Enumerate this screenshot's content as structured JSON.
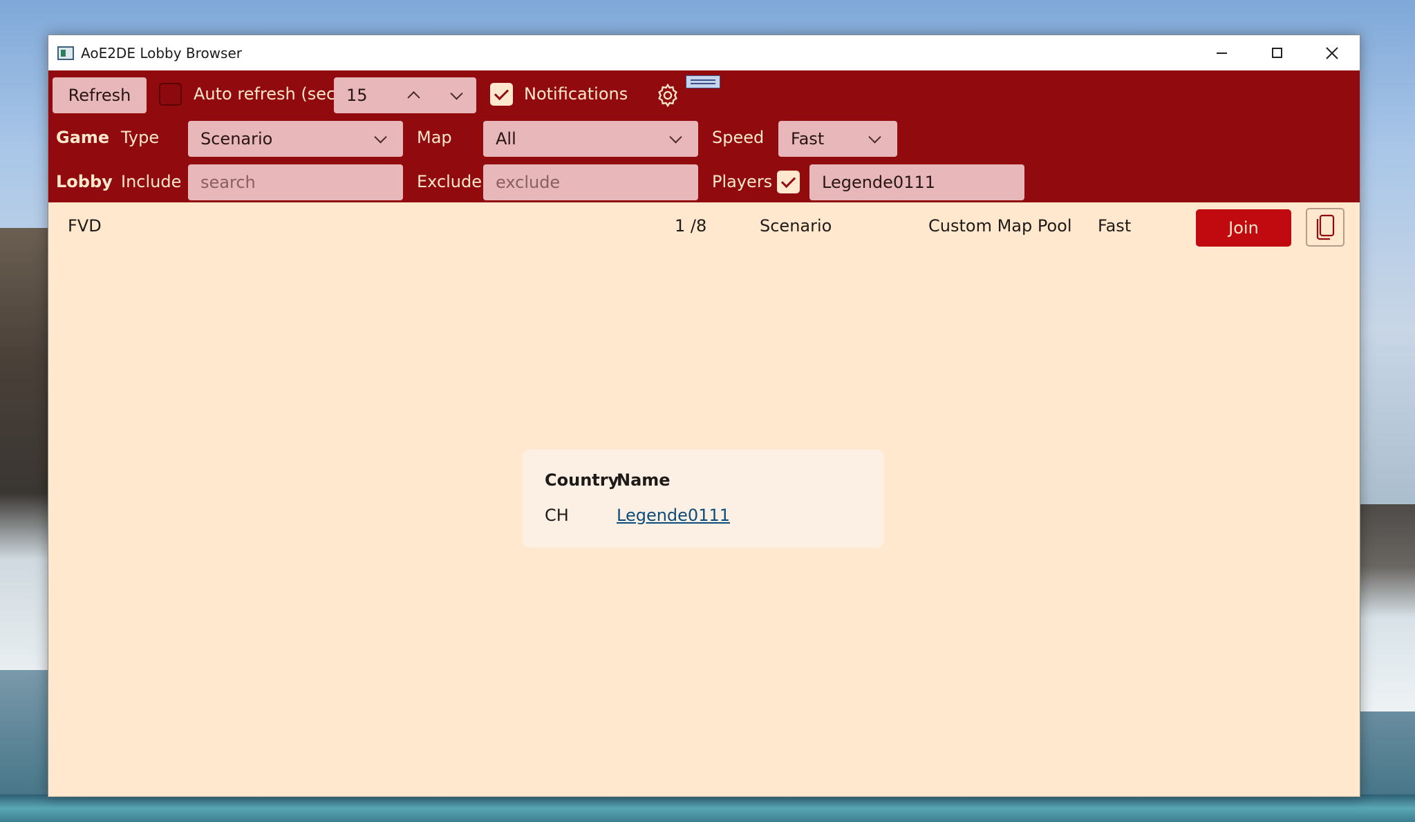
{
  "window": {
    "title": "AoE2DE Lobby Browser",
    "controls": [
      "minimize",
      "maximize",
      "close"
    ]
  },
  "toolbar": {
    "refresh_label": "Refresh",
    "auto_refresh": {
      "label": "Auto refresh (sec)",
      "checked": false,
      "value": "15"
    },
    "notifications": {
      "label": "Notifications",
      "checked": true
    },
    "settings_icon": "gear-icon"
  },
  "game_filters": {
    "section_label": "Game",
    "type": {
      "label": "Type",
      "value": "Scenario"
    },
    "map": {
      "label": "Map",
      "value": "All"
    },
    "speed": {
      "label": "Speed",
      "value": "Fast"
    }
  },
  "lobby_filters": {
    "section_label": "Lobby",
    "include": {
      "label": "Include",
      "placeholder": "search",
      "value": ""
    },
    "exclude": {
      "label": "Exclude",
      "placeholder": "exclude",
      "value": ""
    },
    "players": {
      "label": "Players",
      "checked": true,
      "value": "Legende0111"
    }
  },
  "lobbies": [
    {
      "name": "FVD",
      "players": "1 /8",
      "type": "Scenario",
      "map": "Custom Map Pool",
      "speed": "Fast",
      "join_label": "Join",
      "copy_icon": "copy-icon"
    }
  ],
  "player_table": {
    "headers": {
      "country": "Country",
      "name": "Name"
    },
    "rows": [
      {
        "country": "CH",
        "name": "Legende0111"
      }
    ]
  },
  "colors": {
    "toolbar_bg": "#910b0e",
    "content_bg": "#ffe8cd",
    "join_button": "#c00a10",
    "field_bg": "#e7b7b9"
  }
}
